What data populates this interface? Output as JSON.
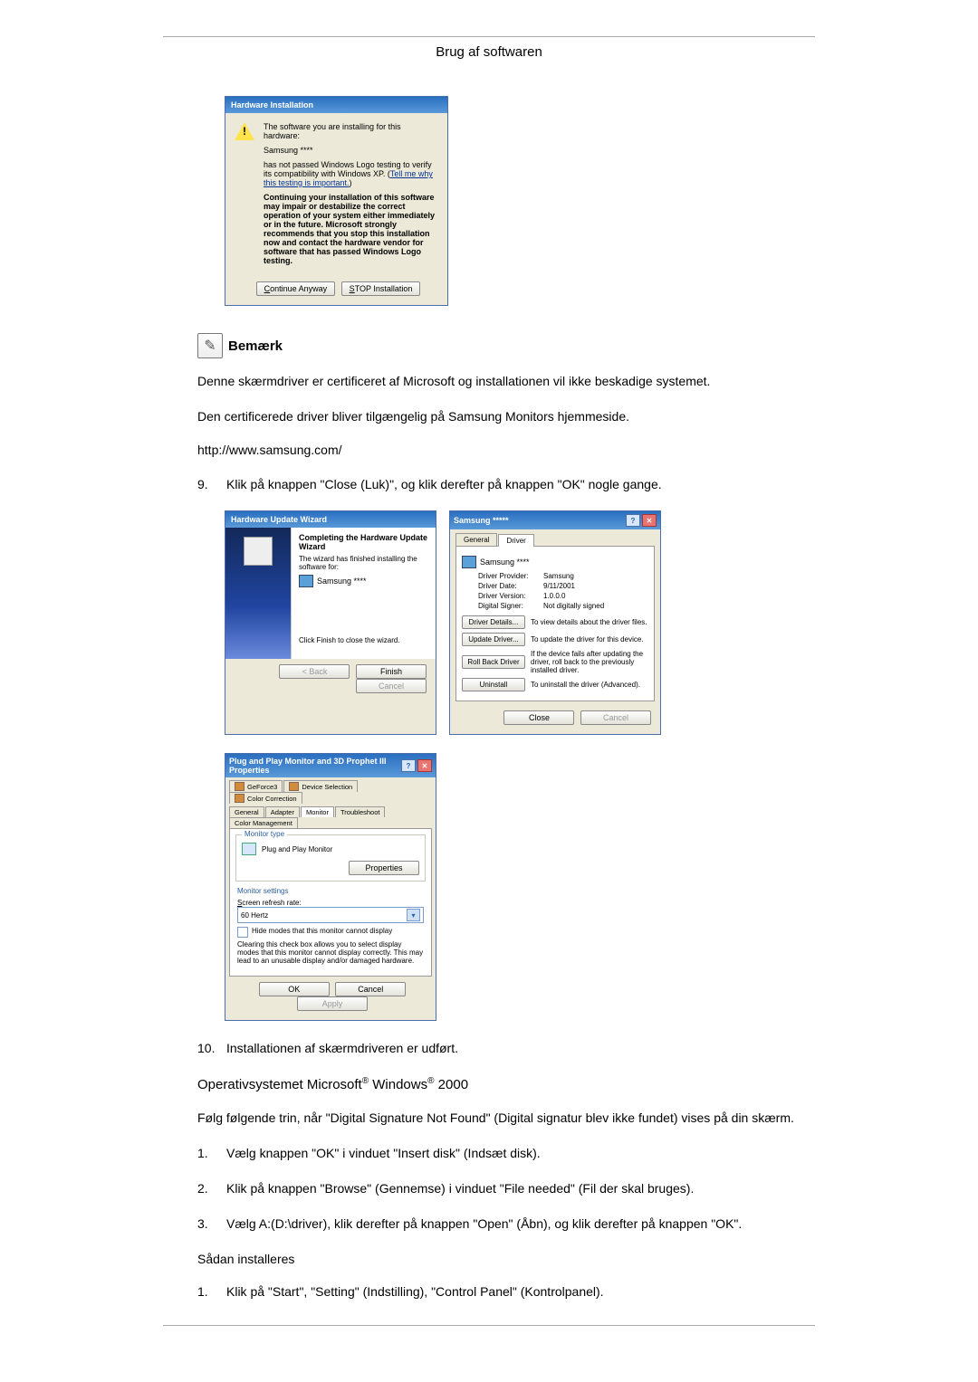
{
  "page_header": "Brug af softwaren",
  "dlg1": {
    "title": "Hardware Installation",
    "intro": "The software you are installing for this hardware:",
    "device": "Samsung ****",
    "notpassed": "has not passed Windows Logo testing to verify its compatibility with Windows XP. (",
    "link": "Tell me why this testing is important.",
    "notpassed_end": ")",
    "warn_bold": "Continuing your installation of this software may impair or destabilize the correct operation of your system either immediately or in the future. Microsoft strongly recommends that you stop this installation now and contact the hardware vendor for software that has passed Windows Logo testing.",
    "btn_continue": "Continue Anyway",
    "btn_stop": "STOP Installation"
  },
  "note": {
    "label": "Bemærk"
  },
  "para1": "Denne skærmdriver er certificeret af Microsoft og installationen vil ikke beskadige systemet.",
  "para2": "Den certificerede driver bliver tilgængelig på Samsung Monitors hjemmeside.",
  "url": "http://www.samsung.com/",
  "step9_num": "9.",
  "step9_text": "Klik på knappen \"Close (Luk)\", og klik derefter på knappen \"OK\" nogle gange.",
  "dlg2": {
    "title": "Hardware Update Wizard",
    "heading": "Completing the Hardware Update Wizard",
    "sub": "The wizard has finished installing the software for:",
    "device": "Samsung ****",
    "finish_hint": "Click Finish to close the wizard.",
    "btn_back": "< Back",
    "btn_finish": "Finish",
    "btn_cancel": "Cancel"
  },
  "dlg3": {
    "title": "Samsung *****",
    "tab_general": "General",
    "tab_driver": "Driver",
    "device": "Samsung ****",
    "kv": {
      "provider_k": "Driver Provider:",
      "provider_v": "Samsung",
      "date_k": "Driver Date:",
      "date_v": "9/11/2001",
      "version_k": "Driver Version:",
      "version_v": "1.0.0.0",
      "signer_k": "Digital Signer:",
      "signer_v": "Not digitally signed"
    },
    "rows": [
      {
        "btn": "Driver Details...",
        "desc": "To view details about the driver files."
      },
      {
        "btn": "Update Driver...",
        "desc": "To update the driver for this device."
      },
      {
        "btn": "Roll Back Driver",
        "desc": "If the device fails after updating the driver, roll back to the previously installed driver."
      },
      {
        "btn": "Uninstall",
        "desc": "To uninstall the driver (Advanced)."
      }
    ],
    "btn_close": "Close",
    "btn_cancel": "Cancel"
  },
  "dlg4": {
    "title": "Plug and Play Monitor and 3D Prophet III Properties",
    "tabs_row1": [
      "GeForce3",
      "Device Selection",
      "Color Correction"
    ],
    "tabs_row2": [
      "General",
      "Adapter",
      "Monitor",
      "Troubleshoot",
      "Color Management"
    ],
    "group_monitor_type": "Monitor type",
    "monitor_name": "Plug and Play Monitor",
    "btn_properties": "Properties",
    "group_monitor_settings": "Monitor settings",
    "refresh_label": "Screen refresh rate:",
    "refresh_value": "60 Hertz",
    "hide_modes": "Hide modes that this monitor cannot display",
    "hide_hint": "Clearing this check box allows you to select display modes that this monitor cannot display correctly. This may lead to an unusable display and/or damaged hardware.",
    "btn_ok": "OK",
    "btn_cancel": "Cancel",
    "btn_apply": "Apply"
  },
  "step10_num": "10.",
  "step10_text": "Installationen af skærmdriveren er udført.",
  "os_heading_pre": "Operativsystemet Microsoft",
  "os_heading_mid": " Windows",
  "os_heading_post": " 2000",
  "os_para": "Følg følgende trin, når \"Digital Signature Not Found\" (Digital signatur blev ikke fundet) vises på din skærm.",
  "os_steps": [
    {
      "n": "1.",
      "t": "Vælg knappen \"OK\" i vinduet \"Insert disk\" (Indsæt disk)."
    },
    {
      "n": "2.",
      "t": "Klik på knappen \"Browse\" (Gennemse) i vinduet \"File needed\" (Fil der skal bruges)."
    },
    {
      "n": "3.",
      "t": "Vælg A:(D:\\driver), klik derefter på knappen \"Open\" (Åbn), og klik derefter på knappen \"OK\"."
    }
  ],
  "install_heading": "Sådan installeres",
  "install_steps": [
    {
      "n": "1.",
      "t": "Klik på \"Start\", \"Setting\" (Indstilling), \"Control Panel\" (Kontrolpanel)."
    }
  ]
}
